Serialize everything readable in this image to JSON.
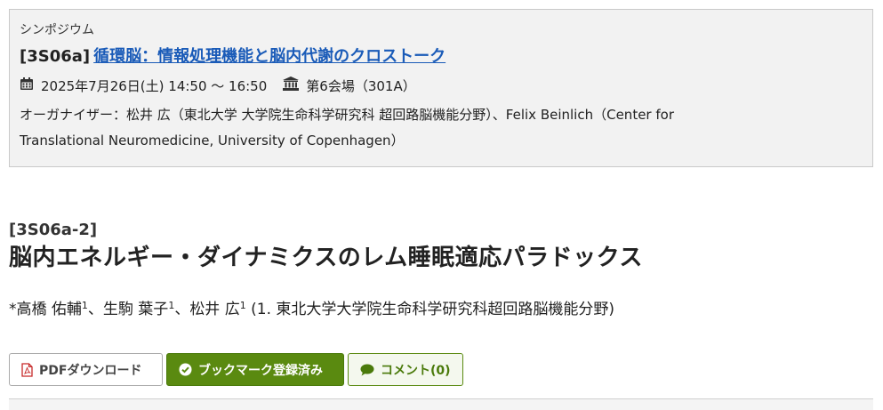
{
  "session": {
    "type": "シンポジウム",
    "code": "[3S06a]",
    "title": "循環脳：情報処理機能と脳内代謝のクロストーク",
    "datetime": "2025年7月26日(土) 14:50 〜 16:50",
    "venue": "第6会場（301A）",
    "organizer_line1": "オーガナイザー：松井 広（東北大学 大学院生命科学研究科 超回路脳機能分野）、Felix Beinlich（Center for",
    "organizer_line2": "Translational Neuromedicine, University of Copenhagen）",
    "icons": {
      "calendar": "calendar-icon",
      "venue": "institution-icon"
    }
  },
  "presentation": {
    "code": "[3S06a-2]",
    "title": "脳内エネルギー・ダイナミクスのレム睡眠適応パラドックス",
    "authors": [
      {
        "name": "*高橋 佑輔",
        "aff": "1",
        "sep": "、"
      },
      {
        "name": "生駒 葉子",
        "aff": "1",
        "sep": "、"
      },
      {
        "name": "松井 広",
        "aff": "1",
        "sep": ""
      }
    ],
    "affiliations": " (1. 東北大学大学院生命科学研究科超回路脳機能分野)"
  },
  "actions": {
    "pdf_label": "PDFダウンロード",
    "bookmark_label": "ブックマーク登録済み",
    "comment_label": "コメント(0)"
  },
  "colors": {
    "link": "#1a5bb8",
    "bookmark_bg": "#5a8a10",
    "comment_text": "#4a7a0b",
    "pdf_icon": "#c62828",
    "session_bg": "#f2f2f2"
  }
}
